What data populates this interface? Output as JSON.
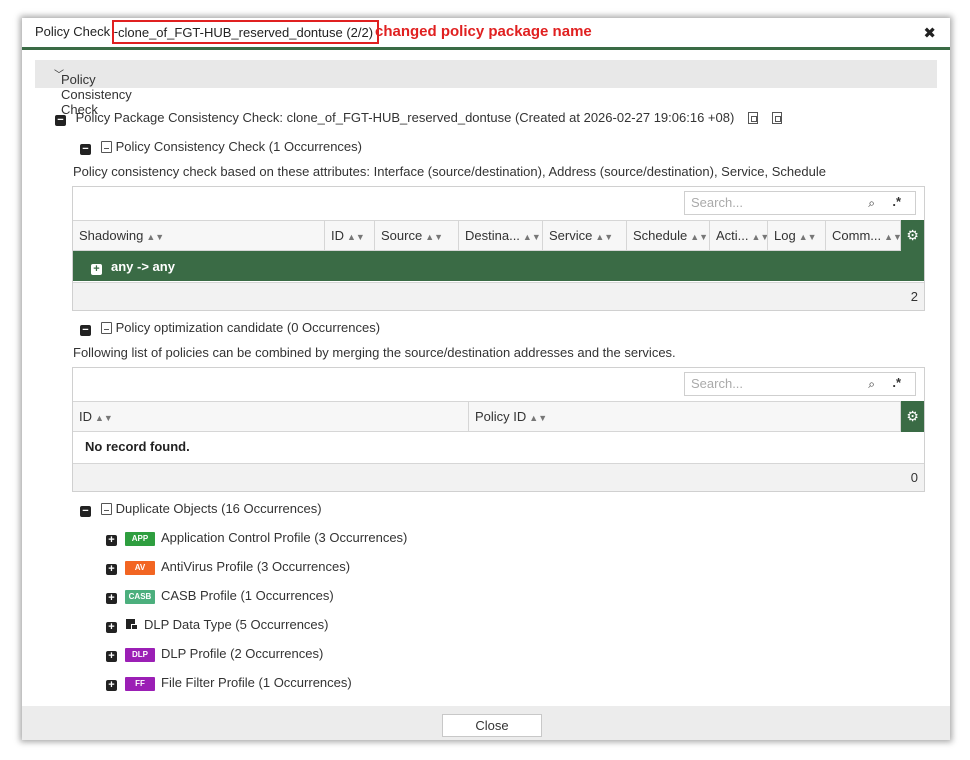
{
  "dialog": {
    "title_prefix": "Policy Check -",
    "title_name": "clone_of_FGT-HUB_reserved_dontuse (2/2)",
    "annotation": "changed policy package name",
    "close_glyph": "✖"
  },
  "section": {
    "label": "Policy Consistency Check"
  },
  "package": {
    "heading": "Policy Package Consistency Check: clone_of_FGT-HUB_reserved_dontuse (Created at 2026-02-27 19:06:16 +08)"
  },
  "consistency": {
    "heading": "Policy Consistency Check (1 Occurrences)",
    "description": "Policy consistency check based on these attributes: Interface (source/destination), Address (source/destination), Service, Schedule",
    "search_placeholder": "Search...",
    "columns": [
      "Shadowing",
      "ID",
      "Source",
      "Destina...",
      "Service",
      "Schedule",
      "Acti...",
      "Log",
      "Comm..."
    ],
    "group_label": "any -> any",
    "count": "2"
  },
  "optimization": {
    "heading": "Policy optimization candidate (0 Occurrences)",
    "description": "Following list of policies can be combined by merging the source/destination addresses and the services.",
    "search_placeholder": "Search...",
    "columns": [
      "ID",
      "Policy ID"
    ],
    "empty_text": "No record found.",
    "count": "0"
  },
  "duplicates": {
    "heading": "Duplicate Objects (16 Occurrences)",
    "items": [
      {
        "badge": "APP",
        "badge_color": "#2e9e3f",
        "label": "Application Control Profile (3 Occurrences)"
      },
      {
        "badge": "AV",
        "badge_color": "#f26522",
        "label": "AntiVirus Profile (3 Occurrences)"
      },
      {
        "badge": "CASB",
        "badge_color": "#4caf7d",
        "label": "CASB Profile (1 Occurrences)"
      },
      {
        "badge": "",
        "badge_color": "",
        "label": "DLP Data Type (5 Occurrences)"
      },
      {
        "badge": "DLP",
        "badge_color": "#9b1fb5",
        "label": "DLP Profile (2 Occurrences)"
      },
      {
        "badge": "FF",
        "badge_color": "#9b1fb5",
        "label": "File Filter Profile (1 Occurrences)"
      }
    ]
  },
  "footer": {
    "close_label": "Close"
  }
}
